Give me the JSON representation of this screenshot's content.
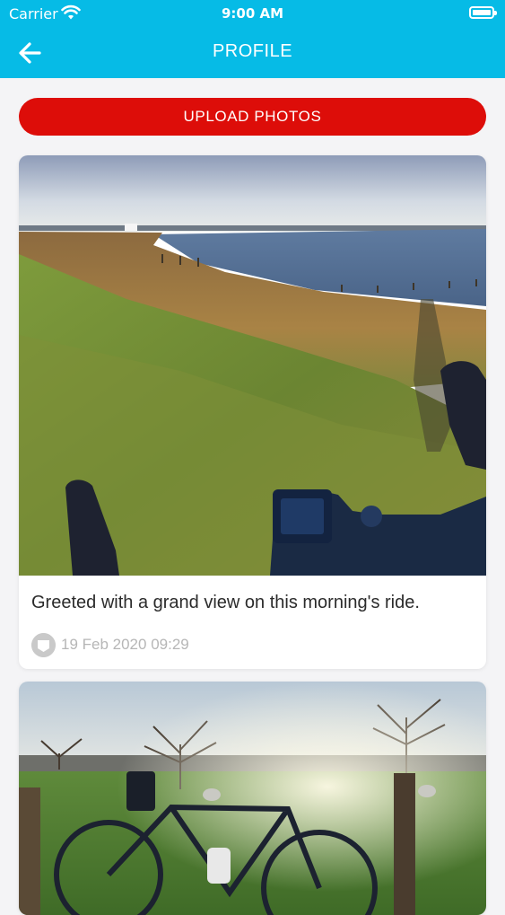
{
  "status_bar": {
    "carrier": "Carrier",
    "time": "9:00 AM"
  },
  "nav": {
    "title": "PROFILE",
    "back_icon": "arrow-left-icon"
  },
  "upload_button": {
    "label": "UPLOAD PHOTOS"
  },
  "posts": [
    {
      "caption": "Greeted with a grand view on this morning's ride.",
      "date": "19 Feb 2020 09:29"
    },
    {}
  ],
  "colors": {
    "header": "#06bbe6",
    "upload_button": "#dd0d09",
    "background": "#f4f4f6"
  }
}
